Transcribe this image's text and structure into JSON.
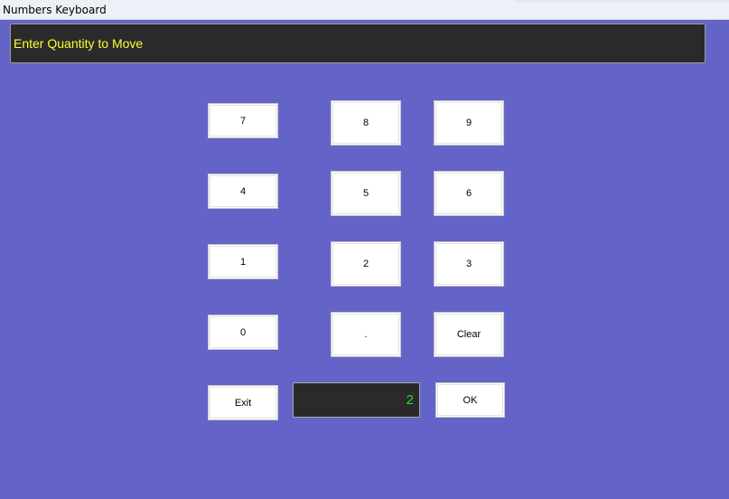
{
  "window": {
    "title": "Numbers Keyboard"
  },
  "prompt": {
    "text": "Enter Quantity to Move"
  },
  "keys": {
    "seven": "7",
    "eight": "8",
    "nine": "9",
    "four": "4",
    "five": "5",
    "six": "6",
    "one": "1",
    "two": "2",
    "three": "3",
    "zero": "0",
    "dot": ".",
    "clear": "Clear",
    "exit": "Exit",
    "ok": "OK"
  },
  "display": {
    "value": "2"
  },
  "colors": {
    "background": "#6464c8",
    "prompt_background": "#2a2a2a",
    "prompt_text": "#ffff33",
    "display_text": "#2bdc2b",
    "key_background": "#ffffff"
  }
}
